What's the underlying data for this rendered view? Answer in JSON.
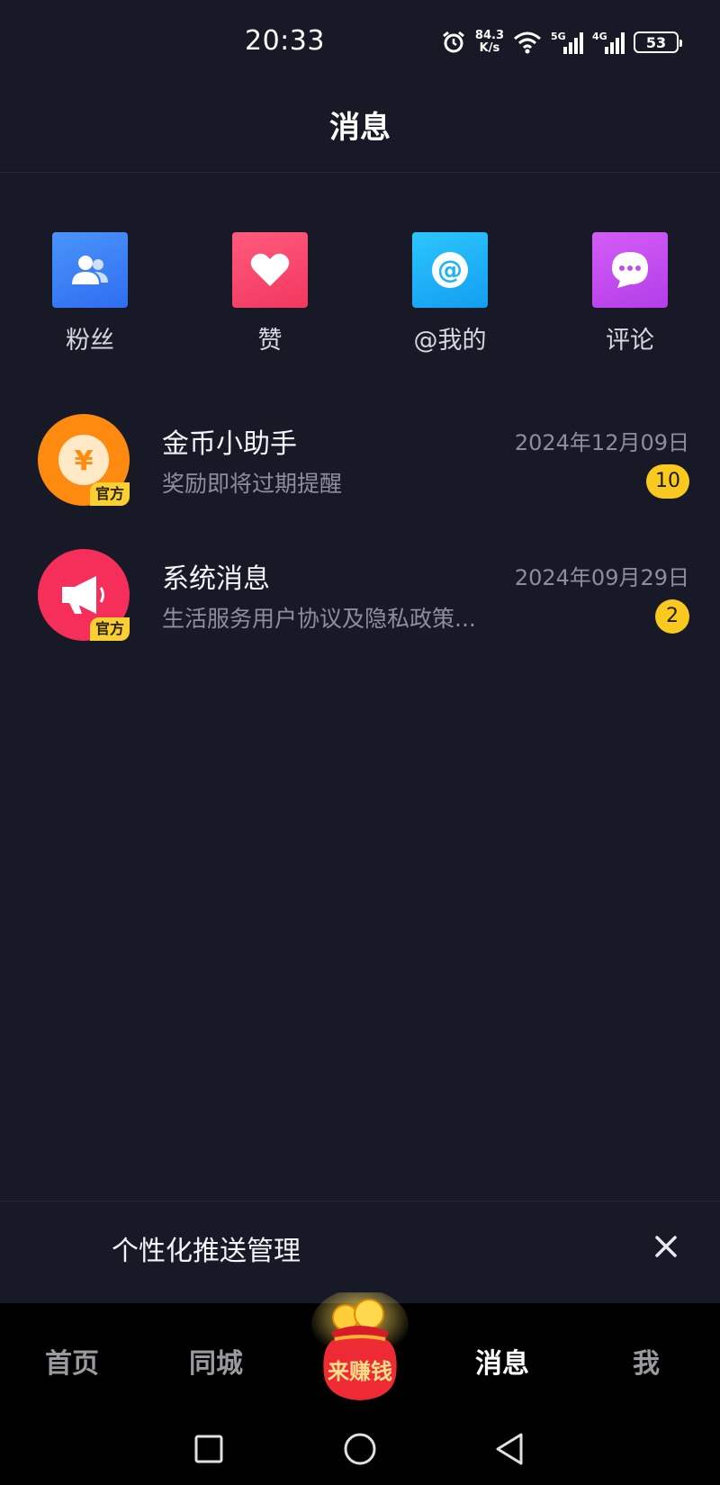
{
  "status_bar": {
    "time": "20:33",
    "net_speed_value": "84.3",
    "net_speed_unit": "K/s",
    "signal_1": "5G",
    "signal_2": "4G",
    "battery": "53"
  },
  "header": {
    "title": "消息"
  },
  "quick_entries": [
    {
      "label": "粉丝",
      "icon": "fans-icon",
      "color": "#3a80f7"
    },
    {
      "label": "赞",
      "icon": "heart-icon",
      "color": "#f7466c"
    },
    {
      "label": "@我的",
      "icon": "at-icon",
      "color": "#1fb4f5"
    },
    {
      "label": "评论",
      "icon": "comment-icon",
      "color": "#c24cf1"
    }
  ],
  "messages": [
    {
      "title": "金币小助手",
      "preview": "奖励即将过期提醒",
      "date": "2024年12月09日",
      "badge": "10",
      "official": "官方",
      "avatar_icon": "yuan-coin-icon",
      "avatar_color": "#ff8a10"
    },
    {
      "title": "系统消息",
      "preview": "生活服务用户协议及隐私政策...",
      "date": "2024年09月29日",
      "badge": "2",
      "official": "官方",
      "avatar_icon": "megaphone-icon",
      "avatar_color": "#f52e5a"
    }
  ],
  "push_banner": {
    "text": "个性化推送管理"
  },
  "tabbar": {
    "home": "首页",
    "local": "同城",
    "earn": "来赚钱",
    "messages": "消息",
    "me": "我"
  }
}
